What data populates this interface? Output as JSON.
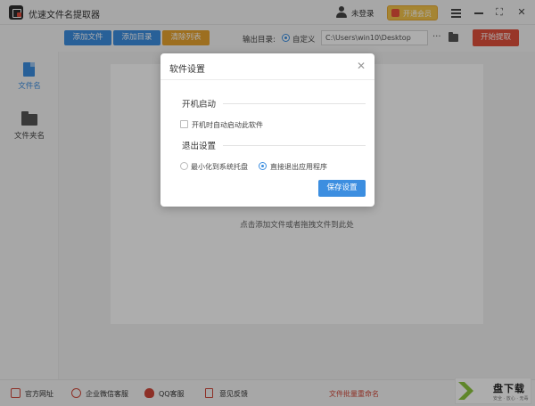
{
  "app": {
    "title": "优速文件名提取器",
    "login_label": "未登录",
    "vip_label": "开通会员",
    "menu_glyph": "≡",
    "max_glyph": "⛶",
    "close_glyph": "✕"
  },
  "toolbar": {
    "add_file": "添加文件",
    "add_dir": "添加目录",
    "clear_list": "清除列表",
    "output_label": "输出目录:",
    "custom_label": "自定义",
    "output_path": "C:\\Users\\win10\\Desktop",
    "more_glyph": "···",
    "start": "开始提取"
  },
  "sidebar": {
    "items": [
      {
        "label": "文件名",
        "active": true
      },
      {
        "label": "文件夹名",
        "active": false
      }
    ]
  },
  "main": {
    "drop_hint": "点击添加文件或者拖拽文件到此处"
  },
  "footer": {
    "website": "官方网址",
    "wechat": "企业微信客服",
    "qq": "QQ客服",
    "feedback": "意见反馈",
    "batch_rename": "文件批量重命名"
  },
  "watermark": {
    "char": "K",
    "name": "盘下载",
    "tagline": "安全 · 放心 · 无毒"
  },
  "dialog": {
    "title": "软件设置",
    "close_glyph": "✕",
    "startup_section": "开机启动",
    "startup_checkbox": "开机时自动启动此软件",
    "startup_checked": false,
    "exit_section": "退出设置",
    "exit_options": [
      {
        "label": "最小化到系统托盘",
        "selected": false
      },
      {
        "label": "直接退出应用程序",
        "selected": true
      }
    ],
    "save": "保存设置"
  },
  "colors": {
    "primary": "#3c8ee0",
    "warning": "#e7a430",
    "danger": "#e0503c",
    "vip": "#f3c44c"
  }
}
